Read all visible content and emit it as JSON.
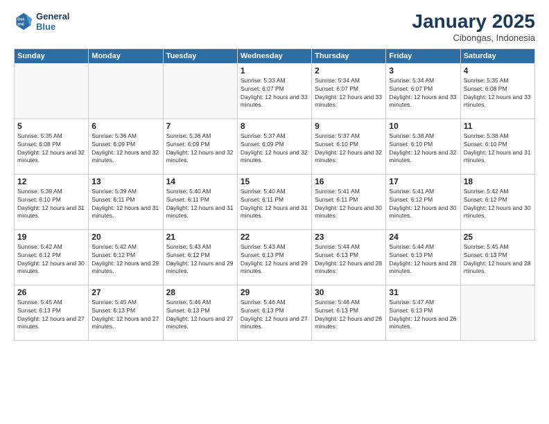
{
  "header": {
    "logo_line1": "General",
    "logo_line2": "Blue",
    "month_title": "January 2025",
    "subtitle": "Cibongas, Indonesia"
  },
  "weekdays": [
    "Sunday",
    "Monday",
    "Tuesday",
    "Wednesday",
    "Thursday",
    "Friday",
    "Saturday"
  ],
  "weeks": [
    [
      {
        "day": "",
        "sunrise": "",
        "sunset": "",
        "daylight": ""
      },
      {
        "day": "",
        "sunrise": "",
        "sunset": "",
        "daylight": ""
      },
      {
        "day": "",
        "sunrise": "",
        "sunset": "",
        "daylight": ""
      },
      {
        "day": "1",
        "sunrise": "Sunrise: 5:33 AM",
        "sunset": "Sunset: 6:07 PM",
        "daylight": "Daylight: 12 hours and 33 minutes."
      },
      {
        "day": "2",
        "sunrise": "Sunrise: 5:34 AM",
        "sunset": "Sunset: 6:07 PM",
        "daylight": "Daylight: 12 hours and 33 minutes."
      },
      {
        "day": "3",
        "sunrise": "Sunrise: 5:34 AM",
        "sunset": "Sunset: 6:07 PM",
        "daylight": "Daylight: 12 hours and 33 minutes."
      },
      {
        "day": "4",
        "sunrise": "Sunrise: 5:35 AM",
        "sunset": "Sunset: 6:08 PM",
        "daylight": "Daylight: 12 hours and 33 minutes."
      }
    ],
    [
      {
        "day": "5",
        "sunrise": "Sunrise: 5:35 AM",
        "sunset": "Sunset: 6:08 PM",
        "daylight": "Daylight: 12 hours and 32 minutes."
      },
      {
        "day": "6",
        "sunrise": "Sunrise: 5:36 AM",
        "sunset": "Sunset: 6:09 PM",
        "daylight": "Daylight: 12 hours and 32 minutes."
      },
      {
        "day": "7",
        "sunrise": "Sunrise: 5:36 AM",
        "sunset": "Sunset: 6:09 PM",
        "daylight": "Daylight: 12 hours and 32 minutes."
      },
      {
        "day": "8",
        "sunrise": "Sunrise: 5:37 AM",
        "sunset": "Sunset: 6:09 PM",
        "daylight": "Daylight: 12 hours and 32 minutes."
      },
      {
        "day": "9",
        "sunrise": "Sunrise: 5:37 AM",
        "sunset": "Sunset: 6:10 PM",
        "daylight": "Daylight: 12 hours and 32 minutes."
      },
      {
        "day": "10",
        "sunrise": "Sunrise: 5:38 AM",
        "sunset": "Sunset: 6:10 PM",
        "daylight": "Daylight: 12 hours and 32 minutes."
      },
      {
        "day": "11",
        "sunrise": "Sunrise: 5:38 AM",
        "sunset": "Sunset: 6:10 PM",
        "daylight": "Daylight: 12 hours and 31 minutes."
      }
    ],
    [
      {
        "day": "12",
        "sunrise": "Sunrise: 5:39 AM",
        "sunset": "Sunset: 6:10 PM",
        "daylight": "Daylight: 12 hours and 31 minutes."
      },
      {
        "day": "13",
        "sunrise": "Sunrise: 5:39 AM",
        "sunset": "Sunset: 6:11 PM",
        "daylight": "Daylight: 12 hours and 31 minutes."
      },
      {
        "day": "14",
        "sunrise": "Sunrise: 5:40 AM",
        "sunset": "Sunset: 6:11 PM",
        "daylight": "Daylight: 12 hours and 31 minutes."
      },
      {
        "day": "15",
        "sunrise": "Sunrise: 5:40 AM",
        "sunset": "Sunset: 6:11 PM",
        "daylight": "Daylight: 12 hours and 31 minutes."
      },
      {
        "day": "16",
        "sunrise": "Sunrise: 5:41 AM",
        "sunset": "Sunset: 6:11 PM",
        "daylight": "Daylight: 12 hours and 30 minutes."
      },
      {
        "day": "17",
        "sunrise": "Sunrise: 5:41 AM",
        "sunset": "Sunset: 6:12 PM",
        "daylight": "Daylight: 12 hours and 30 minutes."
      },
      {
        "day": "18",
        "sunrise": "Sunrise: 5:42 AM",
        "sunset": "Sunset: 6:12 PM",
        "daylight": "Daylight: 12 hours and 30 minutes."
      }
    ],
    [
      {
        "day": "19",
        "sunrise": "Sunrise: 5:42 AM",
        "sunset": "Sunset: 6:12 PM",
        "daylight": "Daylight: 12 hours and 30 minutes."
      },
      {
        "day": "20",
        "sunrise": "Sunrise: 5:42 AM",
        "sunset": "Sunset: 6:12 PM",
        "daylight": "Daylight: 12 hours and 29 minutes."
      },
      {
        "day": "21",
        "sunrise": "Sunrise: 5:43 AM",
        "sunset": "Sunset: 6:12 PM",
        "daylight": "Daylight: 12 hours and 29 minutes."
      },
      {
        "day": "22",
        "sunrise": "Sunrise: 5:43 AM",
        "sunset": "Sunset: 6:13 PM",
        "daylight": "Daylight: 12 hours and 29 minutes."
      },
      {
        "day": "23",
        "sunrise": "Sunrise: 5:44 AM",
        "sunset": "Sunset: 6:13 PM",
        "daylight": "Daylight: 12 hours and 28 minutes."
      },
      {
        "day": "24",
        "sunrise": "Sunrise: 5:44 AM",
        "sunset": "Sunset: 6:13 PM",
        "daylight": "Daylight: 12 hours and 28 minutes."
      },
      {
        "day": "25",
        "sunrise": "Sunrise: 5:45 AM",
        "sunset": "Sunset: 6:13 PM",
        "daylight": "Daylight: 12 hours and 28 minutes."
      }
    ],
    [
      {
        "day": "26",
        "sunrise": "Sunrise: 5:45 AM",
        "sunset": "Sunset: 6:13 PM",
        "daylight": "Daylight: 12 hours and 27 minutes."
      },
      {
        "day": "27",
        "sunrise": "Sunrise: 5:45 AM",
        "sunset": "Sunset: 6:13 PM",
        "daylight": "Daylight: 12 hours and 27 minutes."
      },
      {
        "day": "28",
        "sunrise": "Sunrise: 5:46 AM",
        "sunset": "Sunset: 6:13 PM",
        "daylight": "Daylight: 12 hours and 27 minutes."
      },
      {
        "day": "29",
        "sunrise": "Sunrise: 5:46 AM",
        "sunset": "Sunset: 6:13 PM",
        "daylight": "Daylight: 12 hours and 27 minutes."
      },
      {
        "day": "30",
        "sunrise": "Sunrise: 5:46 AM",
        "sunset": "Sunset: 6:13 PM",
        "daylight": "Daylight: 12 hours and 26 minutes."
      },
      {
        "day": "31",
        "sunrise": "Sunrise: 5:47 AM",
        "sunset": "Sunset: 6:13 PM",
        "daylight": "Daylight: 12 hours and 26 minutes."
      },
      {
        "day": "",
        "sunrise": "",
        "sunset": "",
        "daylight": ""
      }
    ]
  ]
}
